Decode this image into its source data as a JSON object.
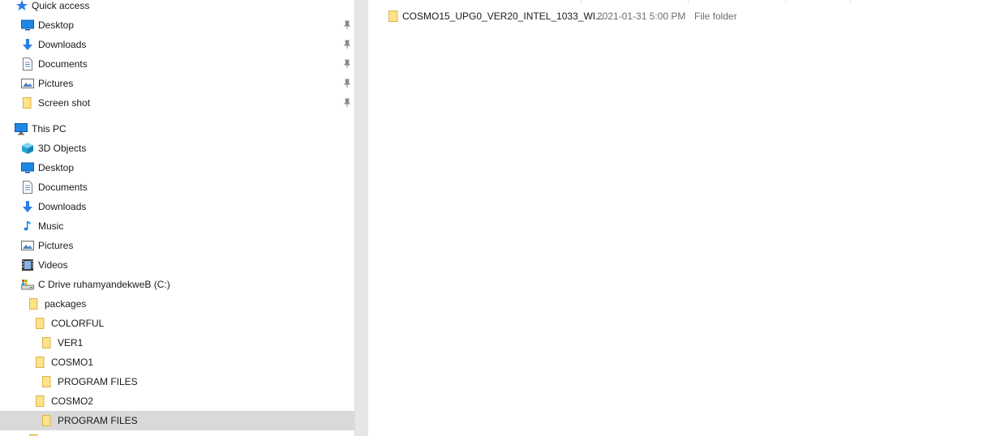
{
  "navigation": {
    "quick_access": {
      "label": "Quick access",
      "items": [
        {
          "label": "Desktop",
          "icon": "desktop-icon",
          "pinned": true
        },
        {
          "label": "Downloads",
          "icon": "download-arrow-icon",
          "pinned": true
        },
        {
          "label": "Documents",
          "icon": "document-icon",
          "pinned": true
        },
        {
          "label": "Pictures",
          "icon": "picture-icon",
          "pinned": true
        },
        {
          "label": "Screen shot",
          "icon": "folder-icon",
          "pinned": true
        }
      ]
    },
    "this_pc": {
      "label": "This PC",
      "items": [
        {
          "label": "3D Objects",
          "icon": "cube-icon"
        },
        {
          "label": "Desktop",
          "icon": "desktop-icon"
        },
        {
          "label": "Documents",
          "icon": "document-icon"
        },
        {
          "label": "Downloads",
          "icon": "download-arrow-icon"
        },
        {
          "label": "Music",
          "icon": "music-note-icon"
        },
        {
          "label": "Pictures",
          "icon": "picture-icon"
        },
        {
          "label": "Videos",
          "icon": "film-icon"
        },
        {
          "label": "C Drive ruhamyandekweB (C:)",
          "icon": "drive-icon"
        }
      ]
    },
    "tree": [
      {
        "label": "packages",
        "icon": "folder-icon"
      },
      {
        "label": "COLORFUL",
        "icon": "folder-icon"
      },
      {
        "label": "VER1",
        "icon": "folder-icon"
      },
      {
        "label": "COSMO1",
        "icon": "folder-icon"
      },
      {
        "label": "PROGRAM FILES",
        "icon": "folder-icon"
      },
      {
        "label": "COSMO2",
        "icon": "folder-icon"
      },
      {
        "label": "PROGRAM FILES",
        "icon": "folder-icon",
        "selected": true
      }
    ]
  },
  "files": [
    {
      "name": "COSMO15_UPG0_VER20_INTEL_1033_WI...",
      "date_modified": "2021-01-31 5:00 PM",
      "type": "File folder",
      "icon": "folder-icon"
    }
  ],
  "colors": {
    "selection": "#d9d9d9",
    "folder": "#ffe28a",
    "accent_blue": "#1e88e5",
    "secondary_text": "#6d6d6d"
  }
}
